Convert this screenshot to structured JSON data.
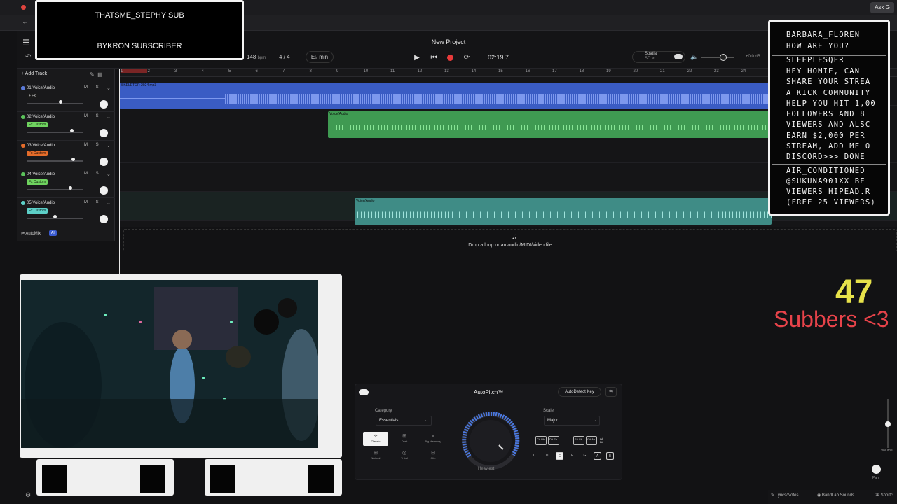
{
  "browser": {
    "ask_label": "Ask G"
  },
  "alerts": {
    "line1": "THATSME_STEPHY SUB",
    "line2": "BYKRON SUBSCRIBER"
  },
  "project": {
    "title": "New Project",
    "tempo": "148",
    "tempo_unit": "bpm",
    "time_signature": "4 / 4",
    "key": "E♭ min",
    "timecode": "02:19.7",
    "spatial_label": "Spatial",
    "spatial_sub": "SD >",
    "db": "+0.0 dB"
  },
  "tracks": {
    "add_label": "Add Track",
    "items": [
      {
        "name": "01 Voice/Audio",
        "fx": "+ Fx",
        "fx_color": "#1a1a1a",
        "fx_text_color": "#cccccc",
        "dot": "#5b7ad8"
      },
      {
        "name": "02 Voice/Audio",
        "fx": "Fx Custom",
        "fx_color": "#6fd35f",
        "fx_text_color": "#102010",
        "dot": "#5bc25a"
      },
      {
        "name": "03 Voice/Audio",
        "fx": "Fx Custom",
        "fx_color": "#e46c2a",
        "fx_text_color": "#201006",
        "dot": "#e46c2a"
      },
      {
        "name": "04 Voice/Audio",
        "fx": "Fx Custom",
        "fx_color": "#6fd35f",
        "fx_text_color": "#102010",
        "dot": "#5bc25a"
      },
      {
        "name": "05 Voice/Audio",
        "fx": "Fx Custom",
        "fx_color": "#5dd0c8",
        "fx_text_color": "#0b2020",
        "dot": "#5dd0c8"
      }
    ],
    "ms_label": "M S",
    "automix_label": "AutoMix",
    "ai_label": "AI"
  },
  "ruler": [
    "1",
    "2",
    "3",
    "4",
    "5",
    "6",
    "7",
    "8",
    "9",
    "10",
    "11",
    "12",
    "13",
    "14",
    "15",
    "16",
    "17",
    "18",
    "19",
    "20",
    "21",
    "22",
    "23",
    "24"
  ],
  "clips": {
    "main_file": "SKELETOR 2024.mp3",
    "voice": "Voice/Audio",
    "voice_short": "Voice/Au..."
  },
  "drop_text": "Drop a loop or an audio/MIDI/video file",
  "chat": {
    "lines": [
      "BARBARA_FLOREN",
      "HOW ARE YOU?",
      "SLEEPLESQER",
      "HEY HOMIE, CAN",
      "SHARE YOUR STREA",
      "A KICK COMMUNITY",
      "HELP YOU HIT 1,00",
      "FOLLOWERS AND 8",
      "VIEWERS AND ALSC",
      "EARN $2,000 PER",
      "STREAM, ADD ME O",
      "DISCORD>>> DONE",
      "AIR_CONDITIONED",
      "@SUKUNA901XX BE",
      "VIEWERS HIPEAD.R",
      "(FREE 25 VIEWERS)"
    ]
  },
  "subs": {
    "count": "47",
    "label": "Subbers <3"
  },
  "autopitch": {
    "title": "AutoPitch™",
    "detect": "AutoDetect Key",
    "category_label": "Category",
    "category_value": "Essentials",
    "scale_label": "Scale",
    "scale_value": "Major",
    "styles": [
      {
        "icon": "✧",
        "label": "Classic",
        "active": true
      },
      {
        "icon": "⊞",
        "label": "Duet",
        "active": false
      },
      {
        "icon": "≡",
        "label": "Big Harmony",
        "active": false
      },
      {
        "icon": "⊞",
        "label": "Natural",
        "active": false
      },
      {
        "icon": "◎",
        "label": "Tribal",
        "active": false
      },
      {
        "icon": "⊟",
        "label": "Clip",
        "active": false
      }
    ],
    "knob_label": "Heaviest",
    "notes": [
      "C",
      "D",
      "E",
      "F",
      "G",
      "A",
      "B"
    ],
    "chords": [
      "C#\nDb",
      "D#\nEb",
      "F#\nGb",
      "G#\nAb",
      "A#\nBb"
    ],
    "accent": "#4a78e0"
  },
  "bottom": {
    "lyrics": "Lyrics/Notes",
    "sounds": "BandLab Sounds",
    "shortcuts": "Shortc",
    "volume": "Volume",
    "pan": "Pan"
  }
}
